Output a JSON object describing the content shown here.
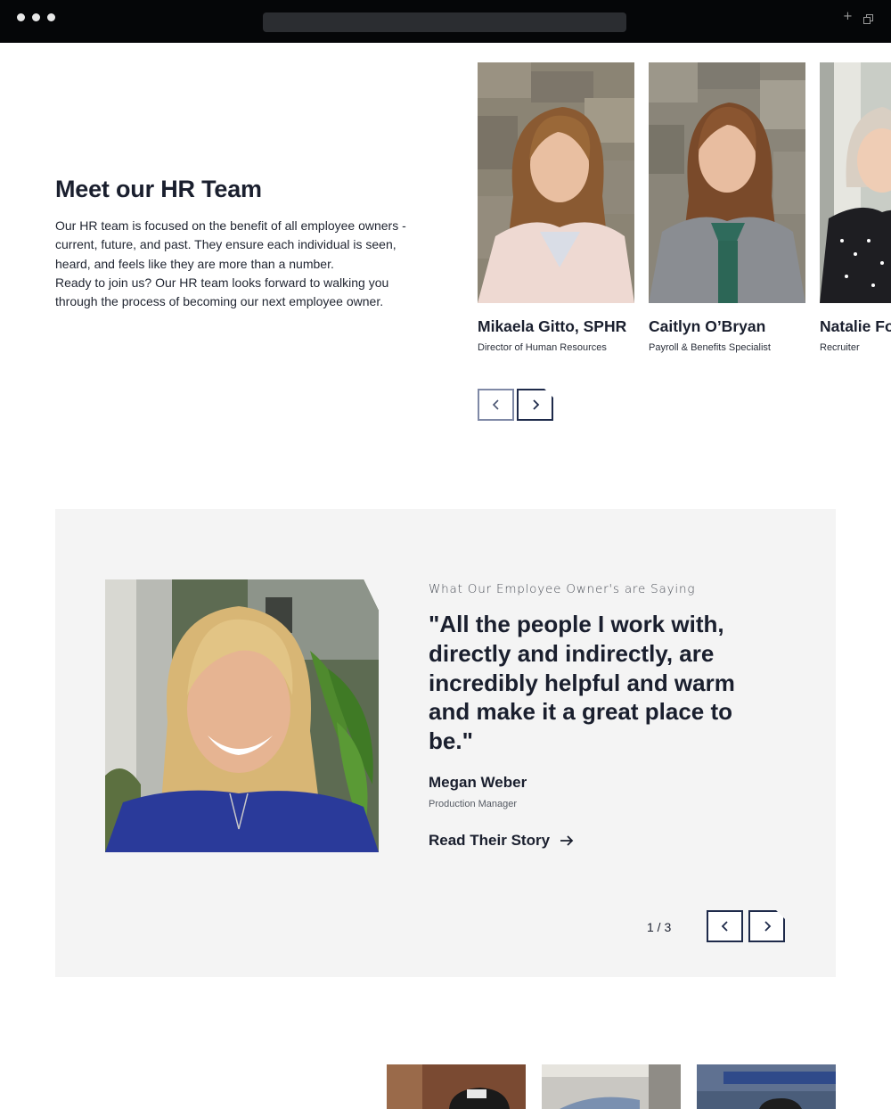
{
  "hr_section": {
    "title": "Meet our HR Team",
    "description_lines": [
      "Our HR team is focused on the benefit of all employee owners - current, future, and past. They ensure each individual is seen, heard, and feels like they are more than a number.",
      "Ready to join us? Our HR team looks forward to walking you through the process of becoming our next employee owner."
    ],
    "team": [
      {
        "name": "Mikaela Gitto, SPHR",
        "role": "Director of Human Resources"
      },
      {
        "name": "Caitlyn O’Bryan",
        "role": "Payroll & Benefits Specialist"
      },
      {
        "name": "Natalie Fo",
        "role": "Recruiter"
      }
    ],
    "prev_icon": "chevron-left-icon",
    "next_icon": "chevron-right-icon"
  },
  "testimonial": {
    "eyebrow": "What Our Employee Owner's are Saying",
    "quote": "\"All the people I work with, directly and indirectly, are incredibly helpful and warm and make it a great place to be.\"",
    "name": "Megan Weber",
    "role": "Production Manager",
    "link_label": "Read Their Story",
    "link_icon": "arrow-right-icon",
    "counter": "1 / 3"
  },
  "colors": {
    "navy": "#1e2a4a",
    "text": "#1a1f2e",
    "panel": "#f4f4f4"
  }
}
